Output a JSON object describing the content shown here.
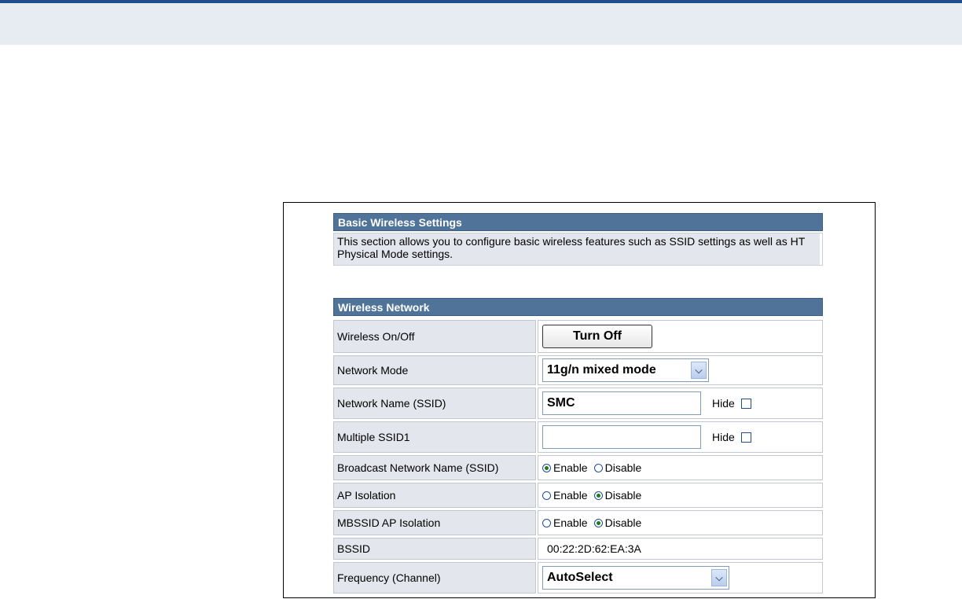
{
  "basic": {
    "title": "Basic Wireless Settings",
    "description": "This section allows you to configure basic wireless features such as SSID settings as well as HT Physical Mode settings."
  },
  "wireless_network": {
    "title": "Wireless Network",
    "rows": {
      "wireless_onoff": {
        "label": "Wireless On/Off",
        "button": "Turn Off"
      },
      "network_mode": {
        "label": "Network Mode",
        "value": "11g/n mixed mode"
      },
      "ssid": {
        "label": "Network Name (SSID)",
        "value": "SMC",
        "hide": "Hide"
      },
      "multiple_ssid": {
        "label": "Multiple SSID1",
        "value": "",
        "hide": "Hide"
      },
      "broadcast": {
        "label": "Broadcast Network Name (SSID)",
        "enable": "Enable",
        "disable": "Disable",
        "selected": "Enable"
      },
      "ap_isolation": {
        "label": "AP Isolation",
        "enable": "Enable",
        "disable": "Disable",
        "selected": "Disable"
      },
      "mbssid_isolation": {
        "label": "MBSSID AP Isolation",
        "enable": "Enable",
        "disable": "Disable",
        "selected": "Disable"
      },
      "bssid": {
        "label": "BSSID",
        "value": "00:22:2D:62:EA:3A"
      },
      "frequency": {
        "label": "Frequency (Channel)",
        "value": "AutoSelect"
      }
    }
  },
  "icons": {
    "dropdown": "chevron-down-icon"
  }
}
